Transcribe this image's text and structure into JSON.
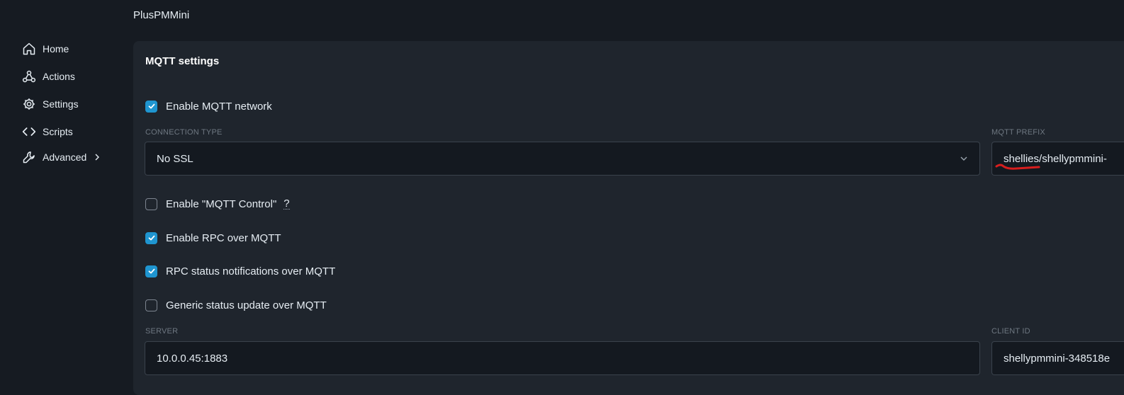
{
  "device": {
    "title": "PlusPMMini"
  },
  "sidebar": {
    "items": [
      {
        "label": "Home",
        "icon": "home-icon"
      },
      {
        "label": "Actions",
        "icon": "actions-icon"
      },
      {
        "label": "Settings",
        "icon": "gear-icon"
      },
      {
        "label": "Scripts",
        "icon": "code-icon"
      },
      {
        "label": "Advanced",
        "icon": "wrench-icon"
      }
    ]
  },
  "mqtt": {
    "title": "MQTT settings",
    "enable_network": {
      "label": "Enable MQTT network",
      "checked": true
    },
    "connection_type": {
      "label": "CONNECTION TYPE",
      "value": "No SSL"
    },
    "prefix": {
      "label": "MQTT PREFIX",
      "value": "shellies/shellypmmini-"
    },
    "mqtt_control": {
      "label": "Enable \"MQTT Control\"",
      "help": "?",
      "checked": false
    },
    "rpc": {
      "label": "Enable RPC over MQTT",
      "checked": true
    },
    "rpc_status": {
      "label": "RPC status notifications over MQTT",
      "checked": true
    },
    "generic_status": {
      "label": "Generic status update over MQTT",
      "checked": false
    },
    "server": {
      "label": "SERVER",
      "value": "10.0.0.45:1883"
    },
    "client_id": {
      "label": "CLIENT ID",
      "value": "shellypmmini-348518e"
    }
  },
  "colors": {
    "accent": "#1f95d0",
    "annotation": "#d81e1e"
  }
}
